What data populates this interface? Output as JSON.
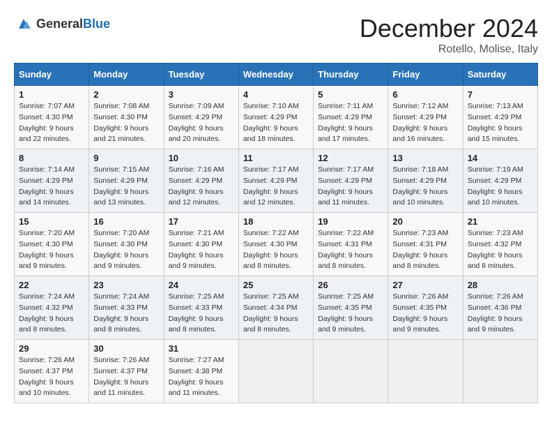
{
  "header": {
    "logo": {
      "text_general": "General",
      "text_blue": "Blue"
    },
    "title": "December 2024",
    "subtitle": "Rotello, Molise, Italy"
  },
  "calendar": {
    "days_of_week": [
      "Sunday",
      "Monday",
      "Tuesday",
      "Wednesday",
      "Thursday",
      "Friday",
      "Saturday"
    ],
    "weeks": [
      [
        {
          "day": "1",
          "sunrise": "7:07 AM",
          "sunset": "4:30 PM",
          "daylight": "9 hours and 22 minutes."
        },
        {
          "day": "2",
          "sunrise": "7:08 AM",
          "sunset": "4:30 PM",
          "daylight": "9 hours and 21 minutes."
        },
        {
          "day": "3",
          "sunrise": "7:09 AM",
          "sunset": "4:29 PM",
          "daylight": "9 hours and 20 minutes."
        },
        {
          "day": "4",
          "sunrise": "7:10 AM",
          "sunset": "4:29 PM",
          "daylight": "9 hours and 18 minutes."
        },
        {
          "day": "5",
          "sunrise": "7:11 AM",
          "sunset": "4:29 PM",
          "daylight": "9 hours and 17 minutes."
        },
        {
          "day": "6",
          "sunrise": "7:12 AM",
          "sunset": "4:29 PM",
          "daylight": "9 hours and 16 minutes."
        },
        {
          "day": "7",
          "sunrise": "7:13 AM",
          "sunset": "4:29 PM",
          "daylight": "9 hours and 15 minutes."
        }
      ],
      [
        {
          "day": "8",
          "sunrise": "7:14 AM",
          "sunset": "4:29 PM",
          "daylight": "9 hours and 14 minutes."
        },
        {
          "day": "9",
          "sunrise": "7:15 AM",
          "sunset": "4:29 PM",
          "daylight": "9 hours and 13 minutes."
        },
        {
          "day": "10",
          "sunrise": "7:16 AM",
          "sunset": "4:29 PM",
          "daylight": "9 hours and 12 minutes."
        },
        {
          "day": "11",
          "sunrise": "7:17 AM",
          "sunset": "4:29 PM",
          "daylight": "9 hours and 12 minutes."
        },
        {
          "day": "12",
          "sunrise": "7:17 AM",
          "sunset": "4:29 PM",
          "daylight": "9 hours and 11 minutes."
        },
        {
          "day": "13",
          "sunrise": "7:18 AM",
          "sunset": "4:29 PM",
          "daylight": "9 hours and 10 minutes."
        },
        {
          "day": "14",
          "sunrise": "7:19 AM",
          "sunset": "4:29 PM",
          "daylight": "9 hours and 10 minutes."
        }
      ],
      [
        {
          "day": "15",
          "sunrise": "7:20 AM",
          "sunset": "4:30 PM",
          "daylight": "9 hours and 9 minutes."
        },
        {
          "day": "16",
          "sunrise": "7:20 AM",
          "sunset": "4:30 PM",
          "daylight": "9 hours and 9 minutes."
        },
        {
          "day": "17",
          "sunrise": "7:21 AM",
          "sunset": "4:30 PM",
          "daylight": "9 hours and 9 minutes."
        },
        {
          "day": "18",
          "sunrise": "7:22 AM",
          "sunset": "4:30 PM",
          "daylight": "9 hours and 8 minutes."
        },
        {
          "day": "19",
          "sunrise": "7:22 AM",
          "sunset": "4:31 PM",
          "daylight": "9 hours and 8 minutes."
        },
        {
          "day": "20",
          "sunrise": "7:23 AM",
          "sunset": "4:31 PM",
          "daylight": "9 hours and 8 minutes."
        },
        {
          "day": "21",
          "sunrise": "7:23 AM",
          "sunset": "4:32 PM",
          "daylight": "9 hours and 8 minutes."
        }
      ],
      [
        {
          "day": "22",
          "sunrise": "7:24 AM",
          "sunset": "4:32 PM",
          "daylight": "9 hours and 8 minutes."
        },
        {
          "day": "23",
          "sunrise": "7:24 AM",
          "sunset": "4:33 PM",
          "daylight": "9 hours and 8 minutes."
        },
        {
          "day": "24",
          "sunrise": "7:25 AM",
          "sunset": "4:33 PM",
          "daylight": "9 hours and 8 minutes."
        },
        {
          "day": "25",
          "sunrise": "7:25 AM",
          "sunset": "4:34 PM",
          "daylight": "9 hours and 8 minutes."
        },
        {
          "day": "26",
          "sunrise": "7:25 AM",
          "sunset": "4:35 PM",
          "daylight": "9 hours and 9 minutes."
        },
        {
          "day": "27",
          "sunrise": "7:26 AM",
          "sunset": "4:35 PM",
          "daylight": "9 hours and 9 minutes."
        },
        {
          "day": "28",
          "sunrise": "7:26 AM",
          "sunset": "4:36 PM",
          "daylight": "9 hours and 9 minutes."
        }
      ],
      [
        {
          "day": "29",
          "sunrise": "7:26 AM",
          "sunset": "4:37 PM",
          "daylight": "9 hours and 10 minutes."
        },
        {
          "day": "30",
          "sunrise": "7:26 AM",
          "sunset": "4:37 PM",
          "daylight": "9 hours and 11 minutes."
        },
        {
          "day": "31",
          "sunrise": "7:27 AM",
          "sunset": "4:38 PM",
          "daylight": "9 hours and 11 minutes."
        },
        null,
        null,
        null,
        null
      ]
    ],
    "labels": {
      "sunrise": "Sunrise:",
      "sunset": "Sunset:",
      "daylight": "Daylight:"
    }
  }
}
